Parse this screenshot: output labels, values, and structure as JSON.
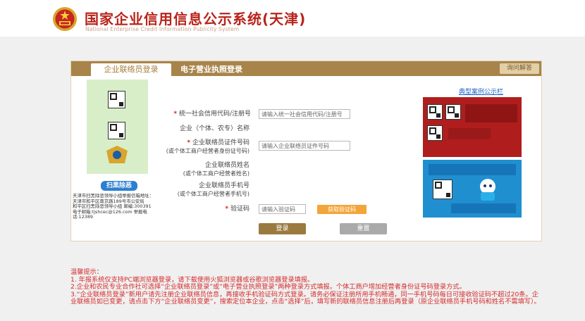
{
  "header": {
    "title": "国家企业信用信息公示系统(天津)",
    "subtitle": "National Enterprise Credit Information Publicity System"
  },
  "tabs": {
    "active": "企业联络员登录",
    "inactive": "电子营业执照登录",
    "help": "询问解答"
  },
  "left_poster": {
    "badge": "扫黑除恶",
    "info_lines": [
      "天津市扫黑除恶领导小组举报信箱地址：",
      "天津市和平区南京路189号市公安局",
      "和平区扫黑除恶领导小组 邮编:300391",
      "电子邮箱:tjshcec@126.com 举报电话:12389"
    ]
  },
  "form": {
    "uscc": {
      "label": "统一社会信用代码/注册号",
      "placeholder": "请输入统一社会信用代码/注册号",
      "required": "*"
    },
    "company_name": {
      "label": "企业（个体、农专）名称"
    },
    "liaison_id": {
      "label": "企业联络员证件号码",
      "sublabel": "(或个体工商户经营者身份证号码)",
      "placeholder": "请输入企业联络员证件号码",
      "required": "*"
    },
    "liaison_name": {
      "label": "企业联络员姓名",
      "sublabel": "(或个体工商户经营者姓名)"
    },
    "liaison_phone": {
      "label": "企业联络员手机号",
      "sublabel": "(或个体工商户经营者手机号)"
    },
    "captcha": {
      "label": "验证码",
      "placeholder": "请输入验证码",
      "required": "*"
    },
    "get_code": "获取验证码",
    "login": "登录",
    "reset": "重置"
  },
  "right": {
    "cases_link": "典型案例公示栏"
  },
  "notice": {
    "title": "温馨提示：",
    "lines": [
      "1. 年报系统仅支持PC端浏览器登录，请下载使用火狐浏览器或谷歌浏览器登录填报。",
      "2.企业和农民专业合作社可选择“企业联络员登录”或“电子营业执照登录”两种登录方式填报。个体工商户增加经营者身份证号码登录方式。",
      "3.“企业联络员登录”新用户请先注册企业联络员信息，再接收手机验证码方式登录。请务必保证注册所用手机畅通，同一手机号码每日可接收验证码不超过20条。企业联络员如已变更，请点击下方“企业联络员变更”，搜索定位本企业，点击“选择”后，填写新的联络员信息注册后再登录（原企业联络员手机号码和姓名不需填写）。"
    ]
  }
}
